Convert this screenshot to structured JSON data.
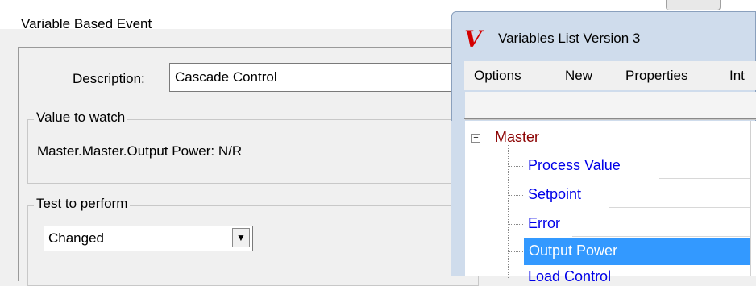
{
  "event_dialog": {
    "title": "Variable Based Event",
    "description_label": "Description:",
    "description_value": "Cascade Control",
    "value_group_label": "Value to watch",
    "value_text": "Master.Master.Output Power: N/R",
    "test_group_label": "Test to perform",
    "test_selected": "Changed"
  },
  "variables_window": {
    "logo": "V",
    "title": "Variables List Version 3",
    "menu": [
      "Options",
      "New",
      "Properties",
      "Int"
    ],
    "tree": {
      "root_expand_glyph": "−",
      "root": "Master",
      "children": [
        "Process Value",
        "Setpoint",
        "Error",
        "Output Power",
        "Load Control"
      ],
      "selected": "Output Power"
    }
  },
  "colors": {
    "selection": "#3399ff",
    "root_text": "#8b0000",
    "child_text": "#0000e8",
    "logo": "#d40000",
    "window_frame": "#cfdcec"
  }
}
